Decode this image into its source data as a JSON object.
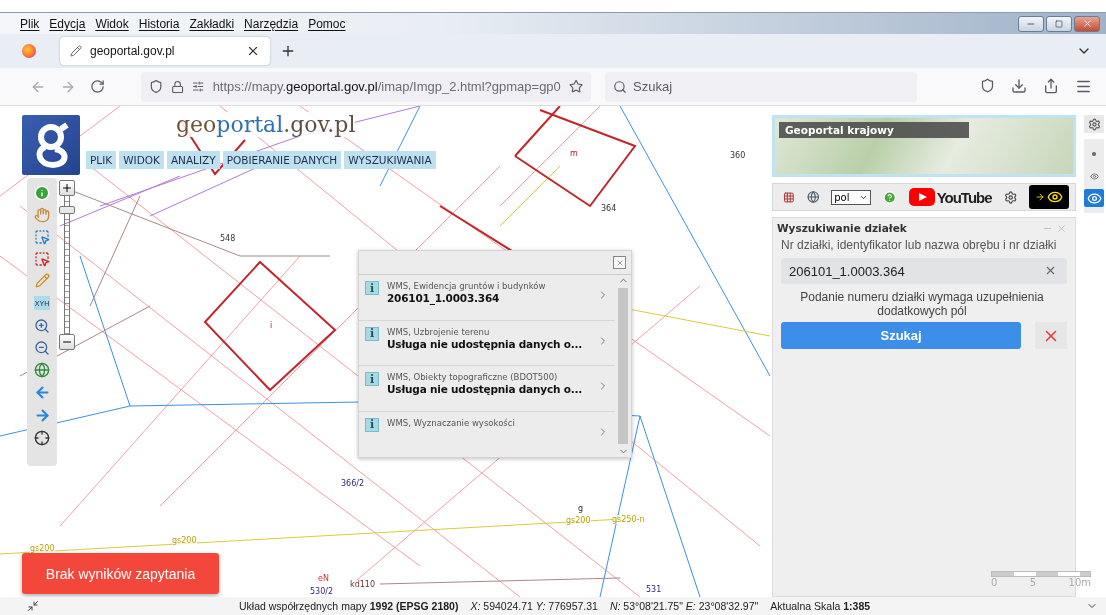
{
  "browser": {
    "menu": [
      "Plik",
      "Edycja",
      "Widok",
      "Historia",
      "Zakładki",
      "Narzędzia",
      "Pomoc"
    ],
    "tab": {
      "title": "geoportal.gov.pl",
      "selected": true
    },
    "url": "https://mapy.**geoportal.gov.pl**/imap/Imgp_2.html?gpmap=gp0",
    "search": {
      "placeholder": "Szukaj"
    }
  },
  "site": {
    "logo_parts": [
      {
        "text": "geo",
        "color": "#6e5236"
      },
      {
        "text": "portal",
        "color": "#2f6fb5"
      },
      {
        "text": ".gov.pl",
        "color": "#5e5044"
      }
    ],
    "menu": [
      "PLIK",
      "WIDOK",
      "ANALIZY",
      "POBIERANIE DANYCH",
      "WYSZUKIWANIA"
    ]
  },
  "tools": {
    "xyh": "XYH"
  },
  "zoom": {
    "level": 0.92
  },
  "map_labels": [
    "360",
    "m",
    "364",
    "548",
    "i",
    "366/2",
    "g",
    "gs200",
    "gs250-n",
    "gs200",
    "eN",
    "kd110",
    "530/2",
    "531",
    "gs200"
  ],
  "popup": {
    "rows": [
      {
        "badge": "i",
        "source": "WMS, Ewidencja gruntów i budynków",
        "value": "206101_1.0003.364"
      },
      {
        "badge": "i",
        "source": "WMS, Uzbrojenie terenu",
        "value": "Usługa nie udostępnia danych o..."
      },
      {
        "badge": "i",
        "source": "WMS, Obiekty topograficzne (BDOT500)",
        "value": "Usługa nie udostępnia danych o..."
      },
      {
        "badge": "i",
        "source": "WMS, Wyznaczanie wysokości"
      }
    ]
  },
  "minimap": {
    "title": "Geoportal krajowy"
  },
  "panel_toolbar": {
    "language": "pol",
    "video": "YouTube"
  },
  "parcel_search": {
    "title": "Wyszukiwanie działek",
    "label": "Nr działki, identyfikator lub nazwa obrębu i nr działki",
    "value": "206101_1.0003.364",
    "note": "Podanie numeru działki wymaga uzupełnienia dodatkowych pól",
    "submit": "Szukaj"
  },
  "layer_views": [
    {
      "kind": "dot",
      "selected": false
    },
    {
      "kind": "eye",
      "selected": false
    },
    {
      "kind": "eye",
      "selected": true
    }
  ],
  "scale_bar": [
    "0",
    "5",
    "10m"
  ],
  "toast": "Brak wyników zapytania",
  "status": {
    "crs": "Układ współrzędnych mapy **1992 (EPSG 2180)**",
    "xy": "*X:* 594024.71 *Y:* 776957.31",
    "ne": "*N:* 53°08'21.75\" *E:* 23°08'32.97\"",
    "scale": "Aktualna Skala **1:385**"
  }
}
